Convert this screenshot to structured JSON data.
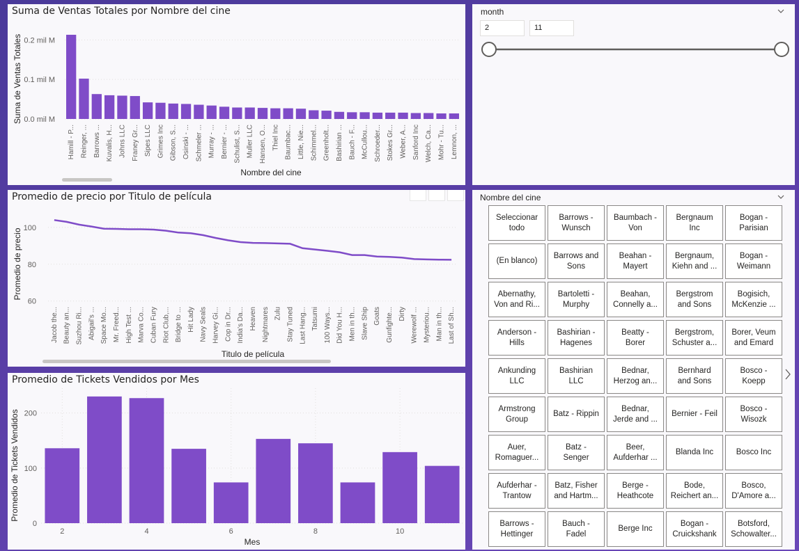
{
  "colors": {
    "bar": "#7f4cc8",
    "line": "#7f4cc8",
    "axis_text": "#605e5c",
    "title_text": "#252423"
  },
  "chart_data": [
    {
      "id": "sales",
      "type": "bar",
      "title": "Suma de Ventas Totales por Nombre del cine",
      "xlabel": "Nombre del cine",
      "ylabel": "Suma de Ventas Totales",
      "ylim": [
        0,
        0.22
      ],
      "y_ticks": [
        {
          "value": 0.0,
          "label": "0.0 mil M"
        },
        {
          "value": 0.1,
          "label": "0.1 mil M"
        },
        {
          "value": 0.2,
          "label": "0.2 mil M"
        }
      ],
      "categories": [
        "Hamill - P...",
        "Reinger, ...",
        "Barrows ...",
        "Kuvalis, H...",
        "Johns LLC",
        "Franey Gr...",
        "Sipes LLC",
        "Grimes Inc",
        "Gibson, S...",
        "Osinski - ...",
        "Schmeler ...",
        "Murray - ...",
        "Bernier - ...",
        "Schulist, S...",
        "Muller LLC",
        "Hansen, O...",
        "Thiel Inc",
        "Baumbac...",
        "Little, Nie...",
        "Schimmel...",
        "Greenholt...",
        "Bashirian ...",
        "Bauch - F...",
        "McCullou...",
        "Schroeder...",
        "Stokes Gr...",
        "Weber, A...",
        "Sanford Inc",
        "Welch, Ca...",
        "Mohr - Tu...",
        "Lemnon, ..."
      ],
      "values": [
        0.213,
        0.102,
        0.063,
        0.06,
        0.059,
        0.058,
        0.042,
        0.041,
        0.039,
        0.038,
        0.036,
        0.034,
        0.031,
        0.029,
        0.029,
        0.028,
        0.027,
        0.027,
        0.026,
        0.022,
        0.021,
        0.018,
        0.017,
        0.017,
        0.016,
        0.016,
        0.016,
        0.015,
        0.015,
        0.014,
        0.014
      ],
      "grid": true
    },
    {
      "id": "price",
      "type": "line",
      "title": "Promedio de precio por Titulo de película",
      "xlabel": "Titulo de película",
      "ylabel": "Promedio de precio",
      "ylim": [
        58,
        106
      ],
      "y_ticks": [
        {
          "value": 60,
          "label": "60"
        },
        {
          "value": 80,
          "label": "80"
        },
        {
          "value": 100,
          "label": "100"
        }
      ],
      "categories": [
        "Jacob the...",
        "Beauty an...",
        "Suzhou Ri...",
        "Abigail's ...",
        "Space Mo...",
        "Mr. Freed...",
        "High Test ...",
        "Marva Co...",
        "Cuban Fury",
        "Riot Club,...",
        "Bridge to ...",
        "Hit Lady",
        "Navy Seals",
        "Harvey Gi...",
        "Cop in Dr...",
        "India's Da...",
        "Heaven",
        "Nightmares",
        "Zulu",
        "Stay Tuned",
        "Last Hang...",
        "Tatsumi",
        "100 Ways...",
        "Did You H...",
        "Men in th...",
        "Slave Ship",
        "Goats",
        "Gunfighte...",
        "Dirty",
        "Werewolf ...",
        "Mysteriou...",
        "Man in th...",
        "Last of Sh..."
      ],
      "values": [
        104,
        103,
        101.5,
        100.5,
        99.3,
        99.2,
        99.0,
        99.0,
        98.8,
        98.2,
        97.2,
        96.8,
        95.8,
        94.3,
        93.0,
        92.0,
        91.6,
        91.5,
        91.3,
        91.1,
        88.7,
        88.0,
        87.3,
        86.5,
        85.0,
        85.0,
        84.2,
        84.0,
        83.6,
        82.8,
        82.6,
        82.5,
        82.4
      ],
      "grid": true
    },
    {
      "id": "tickets",
      "type": "bar",
      "title": "Promedio de Tickets Vendidos por Mes",
      "xlabel": "Mes",
      "ylabel": "Promedio de Tickets Vendidos",
      "ylim": [
        0,
        245
      ],
      "y_ticks": [
        {
          "value": 0,
          "label": "0"
        },
        {
          "value": 100,
          "label": "100"
        },
        {
          "value": 200,
          "label": "200"
        }
      ],
      "x": [
        2,
        3,
        4,
        5,
        6,
        7,
        8,
        9,
        10,
        11
      ],
      "x_tick_labels": [
        "2",
        "4",
        "6",
        "8",
        "10"
      ],
      "values": [
        136,
        230,
        227,
        135,
        74,
        153,
        145,
        74,
        129,
        104
      ],
      "grid": true
    }
  ],
  "month_slicer": {
    "title": "month",
    "min_value": "2",
    "max_value": "11",
    "range_low_fraction": 0.0,
    "range_high_fraction": 1.0
  },
  "cinema_slicer": {
    "title": "Nombre del cine",
    "tiles": [
      "Seleccionar\ntodo",
      "Barrows -\nWunsch",
      "Baumbach -\nVon",
      "Bergnaum\nInc",
      "Bogan -\nParisian",
      "(En blanco)",
      "Barrows and\nSons",
      "Beahan -\nMayert",
      "Bergnaum,\nKiehn and ...",
      "Bogan -\nWeimann",
      "Abernathy,\nVon and Ri...",
      "Bartoletti -\nMurphy",
      "Beahan,\nConnelly a...",
      "Bergstrom\nand Sons",
      "Bogisich,\nMcKenzie ...",
      "Anderson -\nHills",
      "Bashirian -\nHagenes",
      "Beatty -\nBorer",
      "Bergstrom,\nSchuster a...",
      "Borer, Veum\nand Emard",
      "Ankunding\nLLC",
      "Bashirian\nLLC",
      "Bednar,\nHerzog an...",
      "Bernhard\nand Sons",
      "Bosco -\nKoepp",
      "Armstrong\nGroup",
      "Batz - Rippin",
      "Bednar,\nJerde and ...",
      "Bernier - Feil",
      "Bosco -\nWisozk",
      "Auer,\nRomaguer...",
      "Batz -\nSenger",
      "Beer,\nAufderhar ...",
      "Blanda Inc",
      "Bosco Inc",
      "Aufderhar -\nTrantow",
      "Batz, Fisher\nand Hartm...",
      "Berge -\nHeathcote",
      "Bode,\nReichert an...",
      "Bosco,\nD'Amore a...",
      "Barrows -\nHettinger",
      "Bauch -\nFadel",
      "Berge Inc",
      "Bogan -\nCruickshank",
      "Botsford,\nSchowalter..."
    ]
  }
}
